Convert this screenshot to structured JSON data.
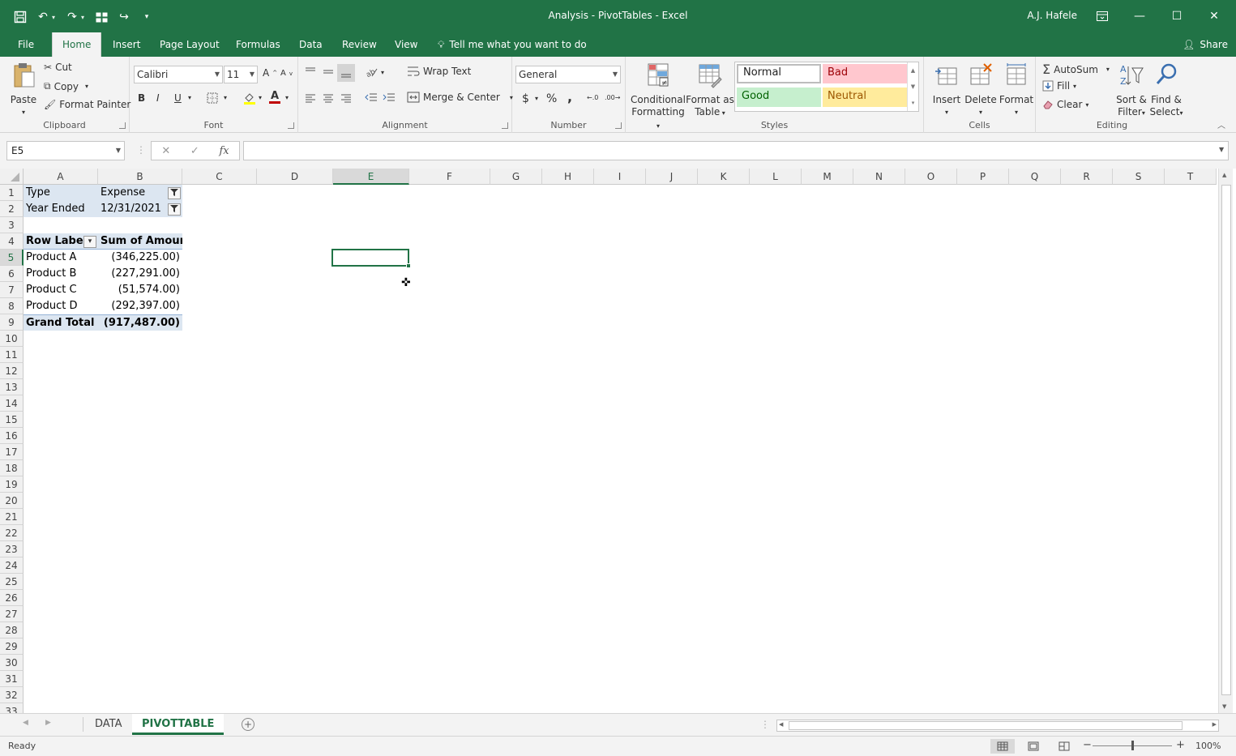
{
  "window": {
    "title": "Analysis - PivotTables  -  Excel",
    "user": "A.J. Hafele"
  },
  "tabs": [
    "File",
    "Home",
    "Insert",
    "Page Layout",
    "Formulas",
    "Data",
    "Review",
    "View"
  ],
  "tell_me": "Tell me what you want to do",
  "share": "Share",
  "ribbon": {
    "clipboard": {
      "label": "Clipboard",
      "paste": "Paste",
      "cut": "Cut",
      "copy": "Copy",
      "format_painter": "Format Painter"
    },
    "font": {
      "label": "Font",
      "family": "Calibri",
      "size": "11",
      "bold": "B",
      "italic": "I",
      "underline": "U",
      "font_color_glyph": "A"
    },
    "alignment": {
      "label": "Alignment",
      "wrap_text": "Wrap Text",
      "merge_center": "Merge & Center"
    },
    "number": {
      "label": "Number",
      "format": "General",
      "currency": "$",
      "percent": "%",
      "comma": ",",
      "inc_decimal": "←.0",
      "dec_decimal": ".00→"
    },
    "styles": {
      "label": "Styles",
      "conditional": [
        "Conditional",
        "Formatting"
      ],
      "format_table": [
        "Format as",
        "Table"
      ],
      "normal": "Normal",
      "bad": "Bad",
      "good": "Good",
      "neutral": "Neutral",
      "colors": {
        "bad_bg": "#ffc7ce",
        "bad_fg": "#9c0006",
        "good_bg": "#c6efce",
        "good_fg": "#006100",
        "neutral_bg": "#ffeb9c",
        "neutral_fg": "#9c5700"
      }
    },
    "cells": {
      "label": "Cells",
      "insert": "Insert",
      "delete": "Delete",
      "format": "Format"
    },
    "editing": {
      "label": "Editing",
      "autosum": "AutoSum",
      "fill": "Fill",
      "clear": "Clear",
      "sort_filter": [
        "Sort &",
        "Filter"
      ],
      "find_select": [
        "Find &",
        "Select"
      ]
    }
  },
  "formula_bar": {
    "name_box": "E5",
    "fx": "fx",
    "formula": ""
  },
  "columns": [
    "A",
    "B",
    "C",
    "D",
    "E",
    "F",
    "G",
    "H",
    "I",
    "J",
    "K",
    "L",
    "M",
    "N",
    "O",
    "P",
    "Q",
    "R",
    "S",
    "T"
  ],
  "rows": [
    "1",
    "2",
    "3",
    "4",
    "5",
    "6",
    "7",
    "8",
    "9",
    "10",
    "11",
    "12",
    "13",
    "14",
    "15",
    "16",
    "17",
    "18",
    "19",
    "20",
    "21",
    "22",
    "23",
    "24",
    "25",
    "26",
    "27",
    "28",
    "29",
    "30",
    "31",
    "32",
    "33"
  ],
  "pivot": {
    "filters": [
      {
        "field": "Type",
        "value": "Expense"
      },
      {
        "field": "Year Ended",
        "value": "12/31/2021"
      }
    ],
    "header": {
      "row_labels": "Row Labels",
      "value_field": "Sum of Amount"
    },
    "rows": [
      {
        "label": "Product A",
        "value": "(346,225.00)"
      },
      {
        "label": "Product B",
        "value": "(227,291.00)"
      },
      {
        "label": "Product C",
        "value": "(51,574.00)"
      },
      {
        "label": "Product D",
        "value": "(292,397.00)"
      }
    ],
    "total": {
      "label": "Grand Total",
      "value": "(917,487.00)"
    }
  },
  "sheets": [
    "DATA",
    "PIVOTTABLE"
  ],
  "active_sheet": "PIVOTTABLE",
  "status": {
    "text": "Ready",
    "zoom": "100%"
  },
  "colors": {
    "accent": "#217346",
    "pivot_fill": "#dce6f1"
  }
}
